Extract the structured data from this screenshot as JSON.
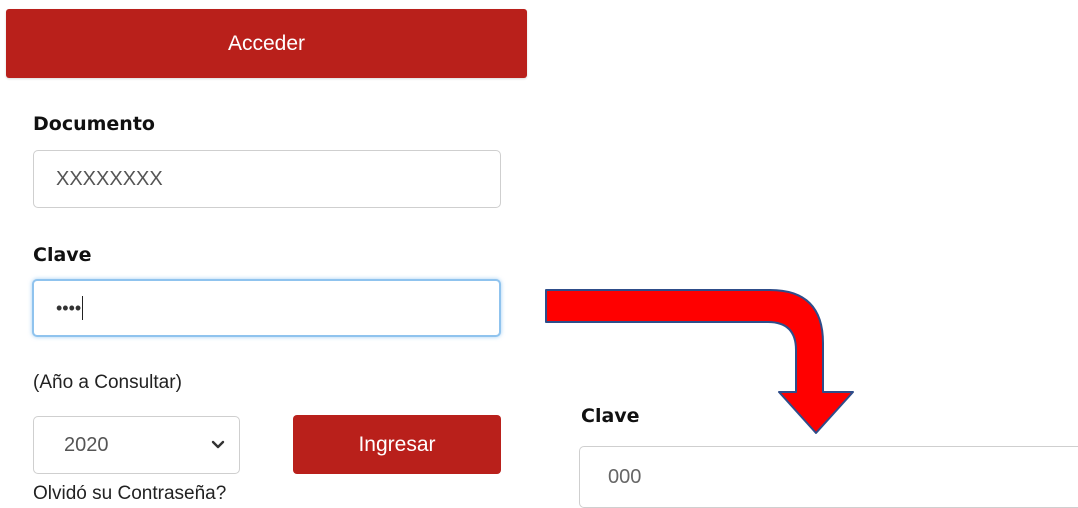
{
  "login": {
    "header_button": "Acceder",
    "document_label": "Documento",
    "document_value": "XXXXXXXX",
    "password_label": "Clave",
    "password_value": "••••",
    "year_label": "(Año a Consultar)",
    "year_selected": "2020",
    "submit_label": "Ingresar",
    "forgot_link": "Olvidó su Contraseña?"
  },
  "annotation": {
    "arrow_color": "#ff0000",
    "zoom_label": "Clave",
    "zoom_value": "000"
  },
  "colors": {
    "brand_red": "#b9201b",
    "focus_blue": "#8fc3ee"
  }
}
